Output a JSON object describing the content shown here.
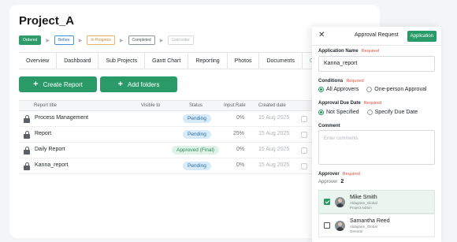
{
  "project": {
    "title": "Project_A",
    "stages": [
      "Ordered",
      "Before",
      "In Progress",
      "Completed",
      "Lost order"
    ]
  },
  "tabs": [
    "Overview",
    "Dashboard",
    "Sub Projects",
    "Gantt Chart",
    "Reporting",
    "Photos",
    "Documents",
    "Custom"
  ],
  "actions": {
    "create_report": "Create Report",
    "add_folders": "Add folders"
  },
  "table": {
    "headers": {
      "title": "Report title",
      "visible": "Visible to",
      "status": "Status",
      "rate": "Input Rate",
      "created": "Created date"
    },
    "rows": [
      {
        "title": "Process Management",
        "status": "Pending",
        "rate": "0%",
        "date": "15 Aug 2025"
      },
      {
        "title": "Report",
        "status": "Pending",
        "rate": "25%",
        "date": "15 Aug 2025"
      },
      {
        "title": "Daily Report",
        "status": "Approved (Final)",
        "rate": "0%",
        "date": "15 Aug 2025"
      },
      {
        "title": "Kanna_report",
        "status": "Pending",
        "rate": "0%",
        "date": "15 Aug 2025"
      }
    ]
  },
  "panel": {
    "title": "Approval Request",
    "apply_label": "Application",
    "app_name_label": "Application Name",
    "required": "Required",
    "app_name_value": "Kanna_report",
    "conditions_label": "Conditions",
    "conditions_options": [
      "All Approvers",
      "One-person Approval"
    ],
    "due_label": "Approval Due Date",
    "due_options": [
      "Not Specified",
      "Specify Due Date"
    ],
    "comment_label": "Comment",
    "comment_placeholder": "Enter comments",
    "approver_label": "Approver",
    "approver_count_label": "Approver",
    "approver_count": "2",
    "approvers": [
      {
        "name": "Mike Smith",
        "org": "Aldagram_Global",
        "role": "Project Admin",
        "checked": true
      },
      {
        "name": "Samantha Reed",
        "org": "Aldagram_Global",
        "role": "General",
        "checked": false
      }
    ]
  },
  "colors": {
    "accent": "#2a9a68",
    "pending_bg": "#d6eaf7",
    "approved_bg": "#dff2e7",
    "required": "#e0503c"
  }
}
